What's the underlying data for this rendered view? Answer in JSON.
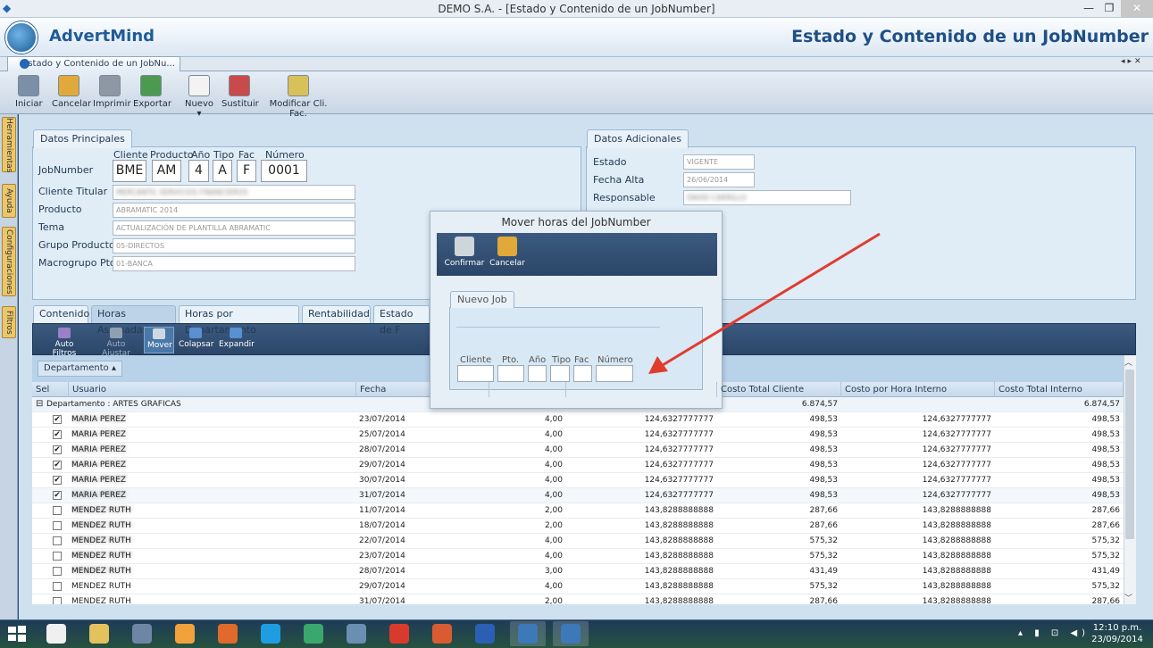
{
  "window": {
    "title": "DEMO S.A. - [Estado y Contenido de un JobNumber]",
    "minimize": "—",
    "restore": "❐",
    "close": "✕"
  },
  "app": {
    "logo": "AdvertMind",
    "page_title": "Estado y Contenido de un JobNumber",
    "doc_tab": "Estado y Contenido de un JobNu...",
    "tab_controls": "◂▸✕"
  },
  "toolbar": [
    {
      "label": "Iniciar",
      "color": "#7b8fa6"
    },
    {
      "label": "Cancelar",
      "color": "#e0a93a"
    },
    {
      "label": "Imprimir",
      "color": "#8e98a4"
    },
    {
      "label": "Exportar",
      "color": "#4c9a4f"
    },
    {
      "label": "Nuevo ▾",
      "color": "#f3f3f3"
    },
    {
      "label": "Sustituir",
      "color": "#c94a4a"
    },
    {
      "label": "Modificar Cli. Fac.",
      "color": "#d9c15a"
    }
  ],
  "sidebar": [
    "Herramientas",
    "Ayuda",
    "Configuraciones",
    "Filtros"
  ],
  "principales": {
    "legend": "Datos Principales",
    "jobnumber_label": "JobNumber",
    "code_headers": [
      "Cliente",
      "Producto",
      "Año",
      "Tipo",
      "Fac",
      "Número"
    ],
    "code_values": [
      "BME",
      "AM",
      "4",
      "A",
      "F",
      "0001"
    ],
    "fields": [
      {
        "label": "Cliente Titular",
        "value": "MERCANTIL SERVICIOS FINANCIEROS",
        "blurred": true
      },
      {
        "label": "Producto",
        "value": "ABRAMATIC 2014",
        "blurred": false
      },
      {
        "label": "Tema",
        "value": "ACTUALIZACIÓN DE PLANTILLA ABRAMATIC",
        "blurred": false
      },
      {
        "label": "Grupo Producto",
        "value": "05-DIRECTOS",
        "blurred": false
      },
      {
        "label": "Macrogrupo Pto",
        "value": "01-BANCA",
        "blurred": false
      }
    ]
  },
  "adicionales": {
    "legend": "Datos Adicionales",
    "fields": [
      {
        "label": "Estado",
        "value": "VIGENTE",
        "blurred": false
      },
      {
        "label": "Fecha Alta",
        "value": "26/06/2014",
        "blurred": false
      },
      {
        "label": "Responsable",
        "value": "DAVID CARRILLO",
        "blurred": true
      }
    ]
  },
  "tabs": [
    "Contenido",
    "Horas Asignadas",
    "Horas por Departamento",
    "Rentabilidad",
    "Estado de F"
  ],
  "inner_toolbar": [
    {
      "label": "Auto Filtros",
      "color": "#9b7fc7",
      "state": ""
    },
    {
      "label": "Auto Ajustar",
      "color": "#8fa0b3",
      "state": "dis"
    },
    {
      "label": "Mover",
      "color": "#cfd8e2",
      "state": "sel"
    },
    {
      "label": "Colapsar",
      "color": "#5a8fd0",
      "state": ""
    },
    {
      "label": "Expandir",
      "color": "#5a8fd0",
      "state": ""
    }
  ],
  "grid": {
    "group_chip": "Departamento ▴",
    "columns": [
      "Sel",
      "Usuario",
      "Fecha",
      "",
      "",
      "Costo Total Cliente",
      "Costo por Hora Interno",
      "Costo Total Interno"
    ],
    "group_row": {
      "label": "Departamento : ARTES GRAFICAS",
      "total_cliente": "6.874,57",
      "total_interno": "6.874,57"
    },
    "rows": [
      {
        "check": "✔",
        "user": "MARIA PEREZ",
        "blurred": true,
        "fecha": "23/07/2014",
        "horas": "4,00",
        "costo_hora_cliente": "124,6327777777",
        "total_cliente": "498,53",
        "costo_hora_interno": "124,6327777777",
        "total_interno": "498,53"
      },
      {
        "check": "✔",
        "user": "MARIA PEREZ",
        "blurred": true,
        "fecha": "25/07/2014",
        "horas": "4,00",
        "costo_hora_cliente": "124,6327777777",
        "total_cliente": "498,53",
        "costo_hora_interno": "124,6327777777",
        "total_interno": "498,53"
      },
      {
        "check": "✔",
        "user": "MARIA PEREZ",
        "blurred": true,
        "fecha": "28/07/2014",
        "horas": "4,00",
        "costo_hora_cliente": "124,6327777777",
        "total_cliente": "498,53",
        "costo_hora_interno": "124,6327777777",
        "total_interno": "498,53"
      },
      {
        "check": "✔",
        "user": "MARIA PEREZ",
        "blurred": true,
        "fecha": "29/07/2014",
        "horas": "4,00",
        "costo_hora_cliente": "124,6327777777",
        "total_cliente": "498,53",
        "costo_hora_interno": "124,6327777777",
        "total_interno": "498,53"
      },
      {
        "check": "✔",
        "user": "MARIA PEREZ",
        "blurred": true,
        "fecha": "30/07/2014",
        "horas": "4,00",
        "costo_hora_cliente": "124,6327777777",
        "total_cliente": "498,53",
        "costo_hora_interno": "124,6327777777",
        "total_interno": "498,53"
      },
      {
        "check": "✔",
        "user": "MARIA PEREZ",
        "blurred": true,
        "fecha": "31/07/2014",
        "horas": "4,00",
        "costo_hora_cliente": "124,6327777777",
        "total_cliente": "498,53",
        "costo_hora_interno": "124,6327777777",
        "total_interno": "498,53"
      },
      {
        "check": "",
        "user": "MENDEZ RUTH",
        "blurred": true,
        "fecha": "11/07/2014",
        "horas": "2,00",
        "costo_hora_cliente": "143,8288888888",
        "total_cliente": "287,66",
        "costo_hora_interno": "143,8288888888",
        "total_interno": "287,66"
      },
      {
        "check": "",
        "user": "MENDEZ RUTH",
        "blurred": true,
        "fecha": "18/07/2014",
        "horas": "2,00",
        "costo_hora_cliente": "143,8288888888",
        "total_cliente": "287,66",
        "costo_hora_interno": "143,8288888888",
        "total_interno": "287,66"
      },
      {
        "check": "",
        "user": "MENDEZ RUTH",
        "blurred": true,
        "fecha": "22/07/2014",
        "horas": "4,00",
        "costo_hora_cliente": "143,8288888888",
        "total_cliente": "575,32",
        "costo_hora_interno": "143,8288888888",
        "total_interno": "575,32"
      },
      {
        "check": "",
        "user": "MENDEZ RUTH",
        "blurred": true,
        "fecha": "23/07/2014",
        "horas": "4,00",
        "costo_hora_cliente": "143,8288888888",
        "total_cliente": "575,32",
        "costo_hora_interno": "143,8288888888",
        "total_interno": "575,32"
      },
      {
        "check": "",
        "user": "MENDEZ RUTH",
        "blurred": true,
        "fecha": "28/07/2014",
        "horas": "3,00",
        "costo_hora_cliente": "143,8288888888",
        "total_cliente": "431,49",
        "costo_hora_interno": "143,8288888888",
        "total_interno": "431,49"
      },
      {
        "check": "",
        "user": "MENDEZ RUTH",
        "blurred": false,
        "fecha": "29/07/2014",
        "horas": "4,00",
        "costo_hora_cliente": "143,8288888888",
        "total_cliente": "575,32",
        "costo_hora_interno": "143,8288888888",
        "total_interno": "575,32"
      },
      {
        "check": "",
        "user": "MENDEZ RUTH",
        "blurred": false,
        "fecha": "31/07/2014",
        "horas": "2,00",
        "costo_hora_cliente": "143,8288888888",
        "total_cliente": "287,66",
        "costo_hora_interno": "143,8288888888",
        "total_interno": "287,66"
      }
    ]
  },
  "dialog": {
    "title": "Mover horas del JobNumber",
    "confirm": "Confirmar",
    "cancel": "Cancelar",
    "legend": "Nuevo Job",
    "labels": [
      "Cliente",
      "Pto.",
      "Año",
      "Tipo",
      "Fac",
      "Número"
    ]
  },
  "taskbar": {
    "time": "12:10 p.m.",
    "date": "23/09/2014",
    "apps": [
      "#f0f0f0",
      "#e3c15c",
      "#6e86a6",
      "#f2a23a",
      "#e06a2b",
      "#1e9de2",
      "#3aa76d",
      "#6a8fb0",
      "#d83b2c",
      "#d95b32",
      "#2b5fb3",
      "#3d78b8",
      "#3d78b8"
    ],
    "tray": "▴ ▮ ⊡ ◀)"
  }
}
